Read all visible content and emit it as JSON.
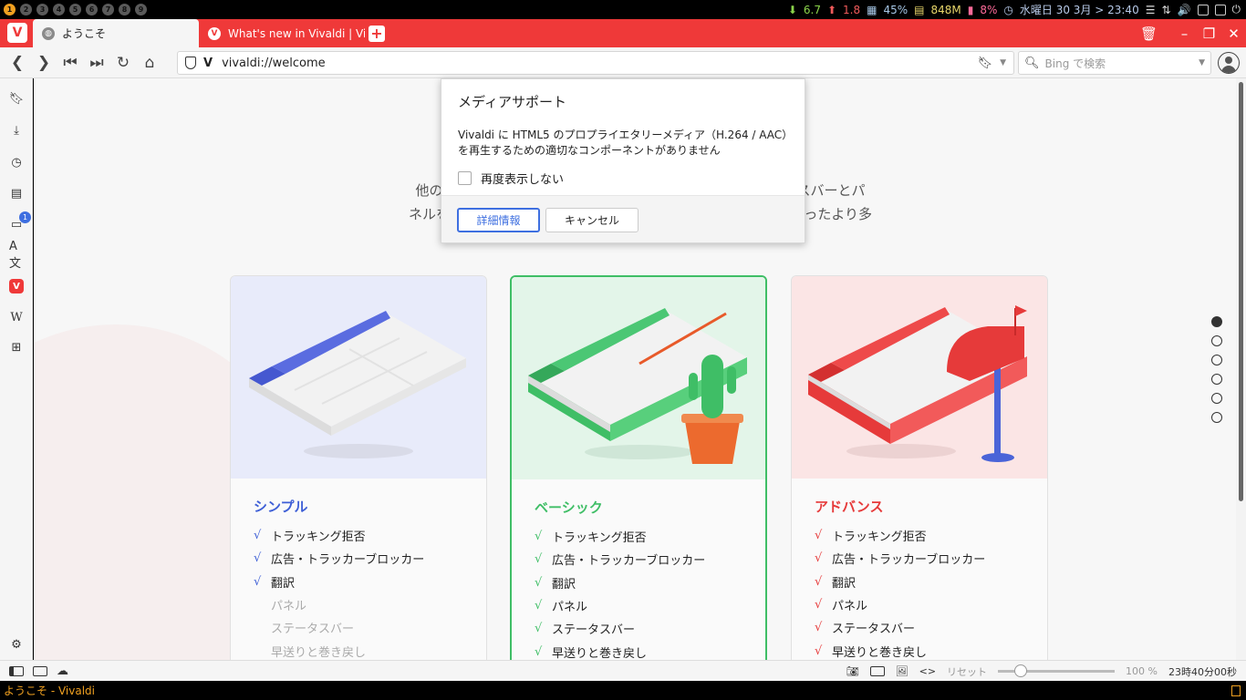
{
  "system_panel": {
    "workspaces": [
      "1",
      "2",
      "3",
      "4",
      "5",
      "6",
      "7",
      "8",
      "9"
    ],
    "net_down": "6.7",
    "net_up": "1.8",
    "cpu": "45%",
    "memory": "848M",
    "battery": "8%",
    "datetime": "水曜日 30 3月 > 23:40"
  },
  "tabs": [
    {
      "title": "ようこそ",
      "active": true
    },
    {
      "title": "What's new in Vivaldi | Vivaldi",
      "active": false
    }
  ],
  "address": {
    "url": "vivaldi://welcome",
    "search_placeholder": "Bing で検索"
  },
  "page": {
    "intro_line1": "他の機能も試して                                                  ステータスバーとパ",
    "intro_line2": "ネルを使用するこ                                                  パネルといったより多"
  },
  "cards": [
    {
      "title": "シンプル",
      "accent": "#3e5fd6",
      "features": [
        {
          "label": "トラッキング拒否",
          "on": true
        },
        {
          "label": "広告・トラッカーブロッカー",
          "on": true
        },
        {
          "label": "翻訳",
          "on": true
        },
        {
          "label": "パネル",
          "on": false
        },
        {
          "label": "ステータスバー",
          "on": false
        },
        {
          "label": "早送りと巻き戻し",
          "on": false
        }
      ]
    },
    {
      "title": "ベーシック",
      "accent": "#3fbe66",
      "features": [
        {
          "label": "トラッキング拒否",
          "on": true
        },
        {
          "label": "広告・トラッカーブロッカー",
          "on": true
        },
        {
          "label": "翻訳",
          "on": true
        },
        {
          "label": "パネル",
          "on": true
        },
        {
          "label": "ステータスバー",
          "on": true
        },
        {
          "label": "早送りと巻き戻し",
          "on": true
        }
      ]
    },
    {
      "title": "アドバンス",
      "accent": "#e63a3a",
      "features": [
        {
          "label": "トラッキング拒否",
          "on": true
        },
        {
          "label": "広告・トラッカーブロッカー",
          "on": true
        },
        {
          "label": "翻訳",
          "on": true
        },
        {
          "label": "パネル",
          "on": true
        },
        {
          "label": "ステータスバー",
          "on": true
        },
        {
          "label": "早送りと巻き戻し",
          "on": true
        }
      ]
    }
  ],
  "check_glyph": "√",
  "dialog": {
    "title": "メディアサポート",
    "message": "Vivaldi に HTML5 のプロプライエタリーメディア（H.264 / AAC）を再生するための適切なコンポーネントがありません",
    "checkbox_label": "再度表示しない",
    "primary_button": "詳細情報",
    "cancel_button": "キャンセル"
  },
  "panel_badge": "1",
  "status": {
    "reset": "リセット",
    "zoom": "100 %",
    "clock": "23時40分00秒"
  },
  "window_title": "ようこそ - Vivaldi",
  "colors": {
    "brand": "#ef3939",
    "link": "#3e6fe0"
  }
}
